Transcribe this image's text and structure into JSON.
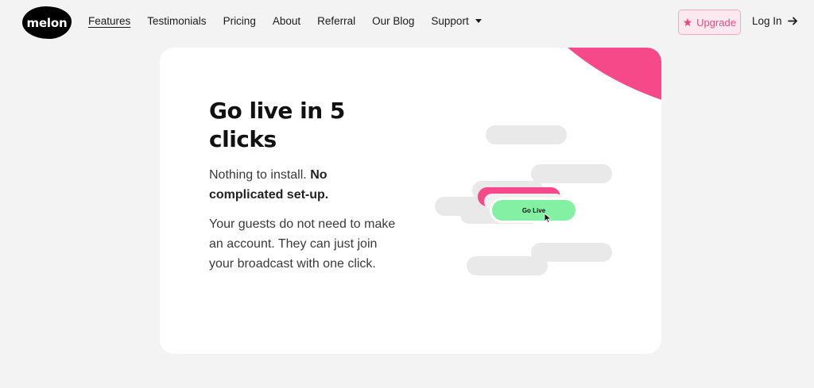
{
  "nav": {
    "logo": "melon",
    "links": [
      "Features",
      "Testimonials",
      "Pricing",
      "About",
      "Referral",
      "Our Blog",
      "Support"
    ],
    "upgrade_label": "Upgrade",
    "login_label": "Log In"
  },
  "hero": {
    "headline": "Go live in 5 clicks",
    "p1_plain": "Nothing to install.",
    "p1_bold": "No complicated set-up.",
    "p2": "Your guests do not need to make an account. They can just join your broadcast with one click."
  },
  "illustration": {
    "button_label": "Go Live"
  },
  "colors": {
    "accent_pink": "#f5498a",
    "go_live_green": "#84f0a3",
    "background": "#f3f3f3"
  }
}
